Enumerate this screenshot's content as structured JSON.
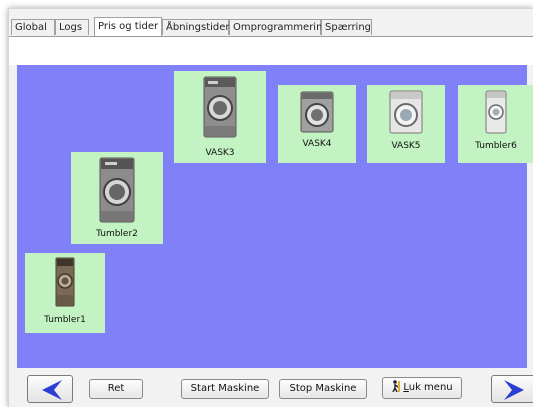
{
  "tabs": [
    {
      "label": "Global"
    },
    {
      "label": "Logs"
    },
    {
      "label": "Pris og tider"
    },
    {
      "label": "Åbningstider"
    },
    {
      "label": "Omprogrammering"
    },
    {
      "label": "Spærring"
    }
  ],
  "active_tab": "Pris og tider",
  "machines": [
    {
      "label": "VASK3"
    },
    {
      "label": "VASK4"
    },
    {
      "label": "VASK5"
    },
    {
      "label": "Tumbler6"
    },
    {
      "label": "Tumbler2"
    },
    {
      "label": "Tumbler1"
    }
  ],
  "toolbar": {
    "ret_label": "Ret",
    "start_label": "Start Maskine",
    "stop_label": "Stop Maskine",
    "close_menu_hotkey": "L",
    "close_menu_label": "uk menu"
  },
  "colors": {
    "canvas": "#8080f8",
    "tile": "#c3f3c3",
    "nav_arrow": "#2b3fd6"
  },
  "icons": {
    "back": "left-arrow-icon",
    "forward": "right-arrow-icon",
    "close_menu": "person-exit-icon"
  }
}
